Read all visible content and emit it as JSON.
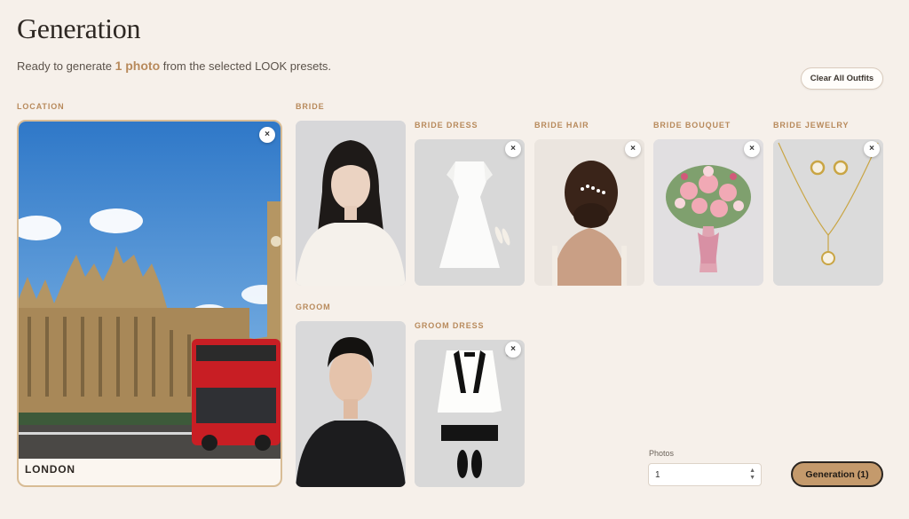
{
  "header": {
    "title": "Generation",
    "subtitle_prefix": "Ready to generate ",
    "subtitle_count": "1 photo",
    "subtitle_suffix": " from the selected LOOK presets.",
    "clear_button": "Clear All Outfits"
  },
  "location": {
    "label": "LOCATION",
    "name": "LONDON",
    "remove_icon": "×"
  },
  "bride": {
    "label": "BRIDE",
    "items": [
      {
        "label": "BRIDE DRESS",
        "remove_icon": "×"
      },
      {
        "label": "BRIDE HAIR",
        "remove_icon": "×"
      },
      {
        "label": "BRIDE BOUQUET",
        "remove_icon": "×"
      },
      {
        "label": "BRIDE JEWELRY",
        "remove_icon": "×"
      }
    ]
  },
  "groom": {
    "label": "GROOM",
    "items": [
      {
        "label": "GROOM DRESS",
        "remove_icon": "×"
      }
    ]
  },
  "controls": {
    "photos_label": "Photos",
    "photos_value": "1",
    "spinner_up": "▲",
    "spinner_down": "▼",
    "generate_button": "Generation (1)"
  },
  "colors": {
    "background": "#f6f0ea",
    "accent": "#b88a5c",
    "button": "#c49a6c"
  }
}
